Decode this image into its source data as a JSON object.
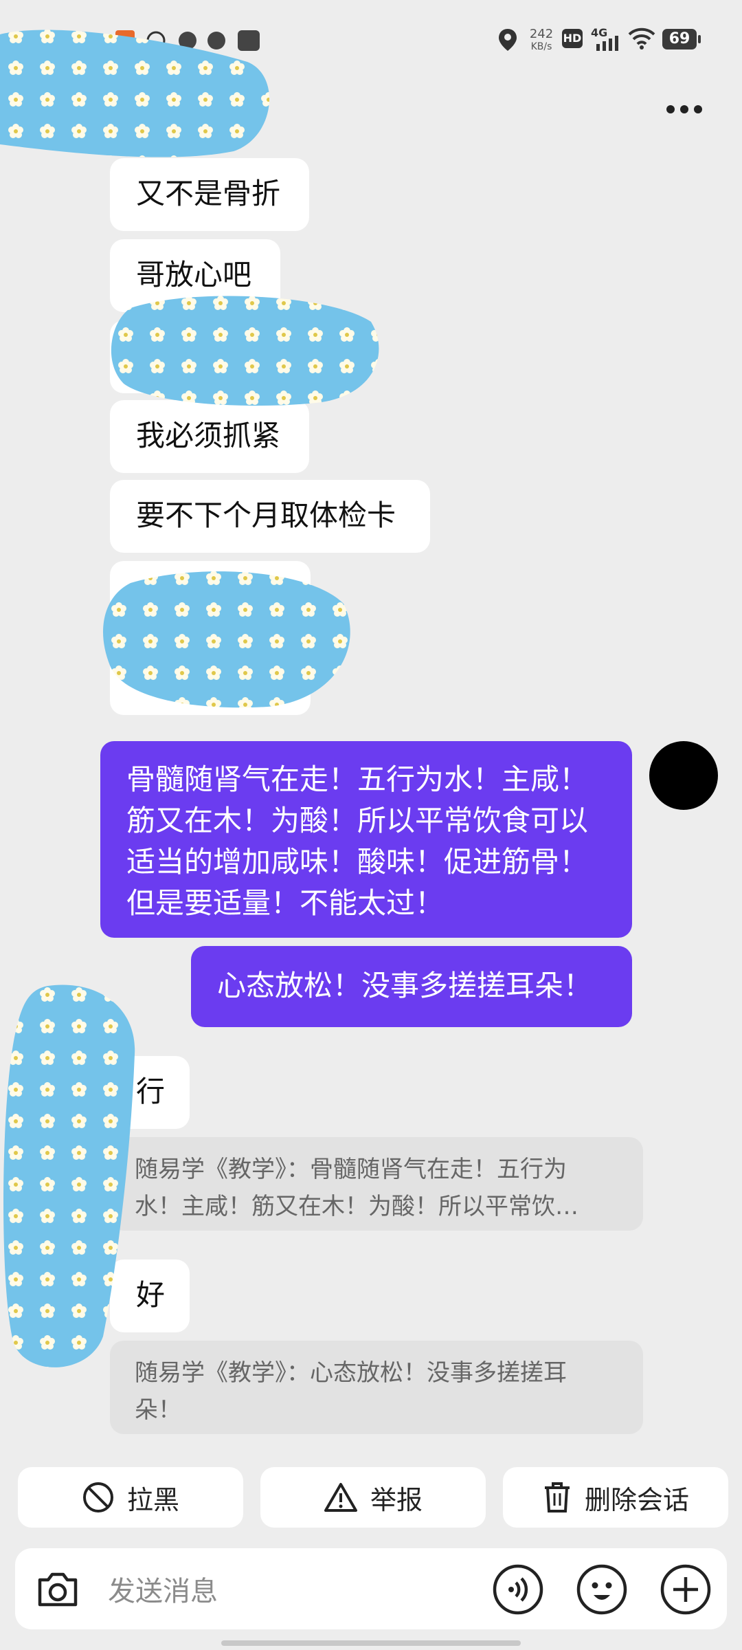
{
  "status_bar": {
    "network_speed_value": "242",
    "network_speed_unit": "KB/s",
    "hd_label": "HD",
    "network_type": "4G",
    "battery": "69"
  },
  "messages": [
    {
      "direction": "in",
      "text": "又不是骨折"
    },
    {
      "direction": "in",
      "text": "哥放心吧"
    },
    {
      "direction": "in",
      "text": "我必须抓紧"
    },
    {
      "direction": "in",
      "text": "要不下个月取体检卡"
    },
    {
      "direction": "out",
      "lines": [
        "骨髓随肾气在走！五行为水！主咸！",
        "筋又在木！为酸！所以平常饮食可以",
        "适当的增加咸味！酸味！促进筋骨！",
        "但是要适量！不能太过！"
      ]
    },
    {
      "direction": "out",
      "text": "心态放松！没事多搓搓耳朵！"
    },
    {
      "direction": "in",
      "text": "行"
    },
    {
      "direction": "quote",
      "lines": [
        "随易学《教学》：骨髓随肾气在走！五行为",
        "水！主咸！筋又在木！为酸！所以平常饮…"
      ]
    },
    {
      "direction": "in",
      "text": "好"
    },
    {
      "direction": "quote",
      "lines": [
        "随易学《教学》：心态放松！没事多搓搓耳",
        "朵！"
      ]
    }
  ],
  "actions": {
    "block_label": "拉黑",
    "report_label": "举报",
    "delete_label": "删除会话"
  },
  "input": {
    "placeholder": "发送消息"
  },
  "colors": {
    "outgoing_bubble": "#6b3cf0",
    "background": "#ededed"
  }
}
